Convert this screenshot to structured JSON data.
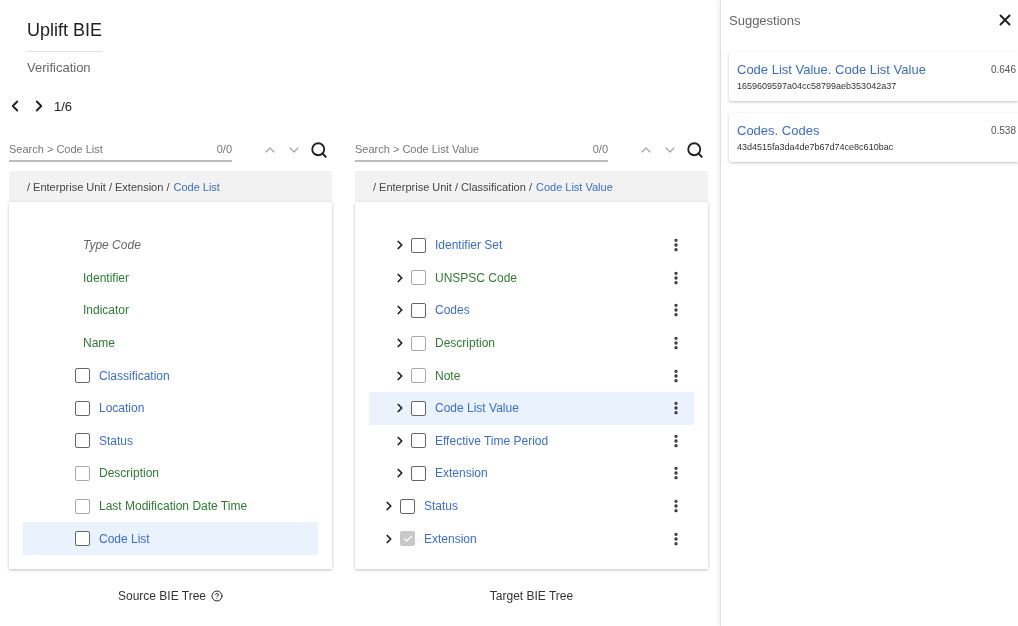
{
  "header": {
    "title": "Uplift BIE",
    "subtitle": "Verification"
  },
  "pager": {
    "position": "1/6"
  },
  "source": {
    "search": {
      "placeholder": "Search > Code List",
      "count": "0/0"
    },
    "breadcrumb": {
      "path": "/ Enterprise Unit / Extension /",
      "current": "Code List"
    },
    "fields": [
      {
        "label": "Type Code",
        "kind": "inactive"
      },
      {
        "label": "Identifier",
        "kind": "attribute"
      },
      {
        "label": "Indicator",
        "kind": "attribute"
      },
      {
        "label": "Name",
        "kind": "attribute"
      }
    ],
    "nodes": [
      {
        "label": "Classification",
        "kind": "association",
        "checked": false,
        "selected": false
      },
      {
        "label": "Location",
        "kind": "association",
        "checked": false,
        "selected": false
      },
      {
        "label": "Status",
        "kind": "association",
        "checked": false,
        "selected": false
      },
      {
        "label": "Description",
        "kind": "attribute",
        "checked": false,
        "selected": false
      },
      {
        "label": "Last Modification Date Time",
        "kind": "attribute",
        "checked": false,
        "selected": false
      },
      {
        "label": "Code List",
        "kind": "association",
        "checked": false,
        "selected": true
      }
    ],
    "caption": "Source BIE Tree"
  },
  "target": {
    "search": {
      "placeholder": "Search > Code List Value",
      "count": "0/0"
    },
    "breadcrumb": {
      "path": "/ Enterprise Unit / Classification /",
      "current": "Code List Value"
    },
    "nodes": [
      {
        "children": [
          {
            "label": "Identifier Set",
            "kind": "association",
            "checked": false,
            "disabled": false,
            "selected": false
          },
          {
            "label": "UNSPSC Code",
            "kind": "attribute",
            "checked": false,
            "disabled": false,
            "selected": false
          },
          {
            "label": "Codes",
            "kind": "association",
            "checked": false,
            "disabled": false,
            "selected": false
          },
          {
            "label": "Description",
            "kind": "attribute",
            "checked": false,
            "disabled": false,
            "selected": false
          },
          {
            "label": "Note",
            "kind": "attribute",
            "checked": false,
            "disabled": false,
            "selected": false
          },
          {
            "label": "Code List Value",
            "kind": "association",
            "checked": false,
            "disabled": false,
            "selected": true
          },
          {
            "label": "Effective Time Period",
            "kind": "association",
            "checked": false,
            "disabled": false,
            "selected": false
          },
          {
            "label": "Extension",
            "kind": "association",
            "checked": false,
            "disabled": false,
            "selected": false
          }
        ]
      },
      {
        "label": "Status",
        "kind": "association",
        "checked": false,
        "disabled": false,
        "selected": false
      },
      {
        "label": "Extension",
        "kind": "association",
        "checked": true,
        "disabled": true,
        "selected": false
      }
    ],
    "caption": "Target BIE Tree"
  },
  "suggestions": {
    "title": "Suggestions",
    "items": [
      {
        "name": "Code List Value. Code List Value",
        "id": "1659609597a04cc58799aeb353042a37",
        "score": "0.646"
      },
      {
        "name": "Codes. Codes",
        "id": "43d4515fa3da4de7b67d74ce8c610bac",
        "score": "0.538"
      }
    ]
  }
}
